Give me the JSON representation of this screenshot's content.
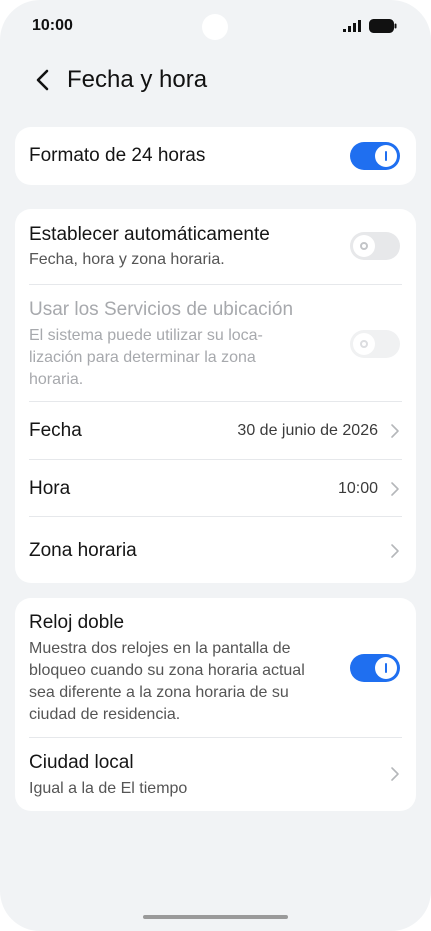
{
  "status_bar": {
    "time": "10:00",
    "signal_icon": "signal-bars-icon",
    "battery_icon": "battery-icon"
  },
  "header": {
    "back_icon": "chevron-left-icon",
    "title": "Fecha y hora"
  },
  "cards": {
    "format": {
      "label": "Formato de 24 horas",
      "enabled": true
    },
    "auto": {
      "label": "Establecer automáticamente",
      "sublabel": "Fecha, hora y zona horaria.",
      "enabled": false
    },
    "location": {
      "label": "Usar los Servicios de ubicación",
      "sublabel_lines": [
        "El sistema puede utilizar su loca-",
        "lización para determinar la zona",
        "horaria."
      ],
      "enabled": false,
      "disabled": true
    },
    "date": {
      "label": "Fecha",
      "value": "30 de junio de 2026"
    },
    "time": {
      "label": "Hora",
      "value": "10:00"
    },
    "timezone": {
      "label": "Zona horaria",
      "value": ""
    },
    "dual_clock": {
      "label": "Reloj doble",
      "sublabel_lines": [
        "Muestra dos relojes en la pantalla de",
        "bloqueo cuando su zona horaria actual",
        "sea diferente a la zona horaria de su",
        "ciudad de residencia."
      ],
      "enabled": true
    },
    "home_city": {
      "label": "Ciudad local",
      "sublabel": "Igual a la de El tiempo"
    }
  },
  "colors": {
    "accent": "#1f6ff0",
    "background": "#f1f3f5",
    "card": "#ffffff"
  }
}
